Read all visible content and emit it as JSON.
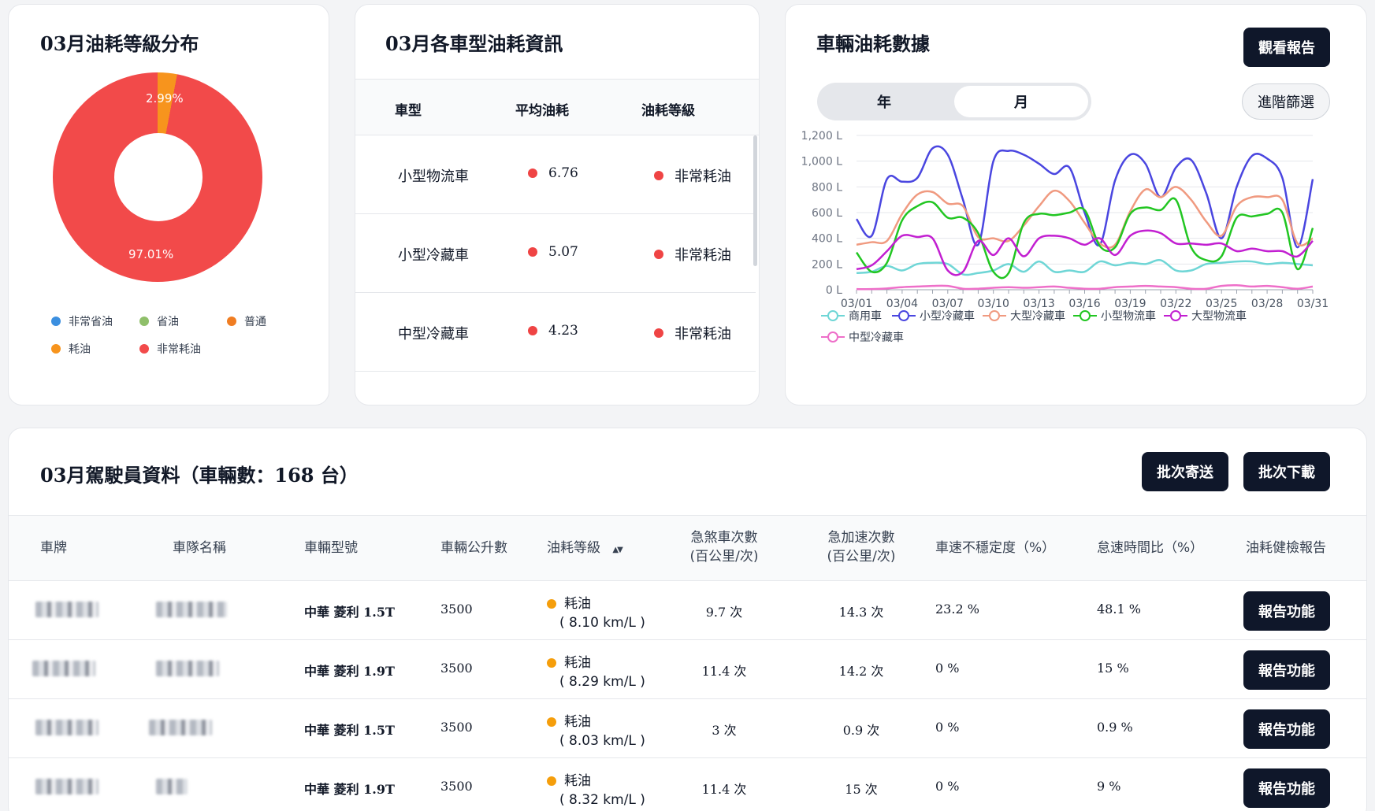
{
  "dist_card": {
    "title": "03月油耗等級分布",
    "slice_small_label": "2.99%",
    "slice_big_label": "97.01%",
    "legend": [
      {
        "label": "非常省油",
        "color": "#3b8fe0"
      },
      {
        "label": "省油",
        "color": "#8fbf6a"
      },
      {
        "label": "普通",
        "color": "#f07d22"
      },
      {
        "label": "耗油",
        "color": "#f7941d"
      },
      {
        "label": "非常耗油",
        "color": "#f24a4a"
      }
    ]
  },
  "model_card": {
    "title": "03月各車型油耗資訊",
    "headers": [
      "車型",
      "平均油耗",
      "油耗等級"
    ],
    "rows": [
      {
        "model": "小型物流車",
        "avg": "6.76",
        "grade": "非常耗油"
      },
      {
        "model": "小型冷藏車",
        "avg": "5.07",
        "grade": "非常耗油"
      },
      {
        "model": "中型冷藏車",
        "avg": "4.23",
        "grade": "非常耗油"
      }
    ]
  },
  "fuel_card": {
    "title": "車輛油耗數據",
    "report_button": "觀看報告",
    "filter_button": "進階篩選",
    "seg_year": "年",
    "seg_month": "月"
  },
  "chart_data": {
    "type": "line",
    "categories": [
      "03/01",
      "03/02",
      "03/03",
      "03/04",
      "03/05",
      "03/06",
      "03/07",
      "03/08",
      "03/09",
      "03/10",
      "03/11",
      "03/12",
      "03/13",
      "03/14",
      "03/15",
      "03/16",
      "03/17",
      "03/18",
      "03/19",
      "03/20",
      "03/21",
      "03/22",
      "03/23",
      "03/24",
      "03/25",
      "03/26",
      "03/27",
      "03/28",
      "03/29",
      "03/30",
      "03/31"
    ],
    "tick_labels": [
      "03/01",
      "03/04",
      "03/07",
      "03/10",
      "03/13",
      "03/16",
      "03/19",
      "03/22",
      "03/25",
      "03/28",
      "03/31"
    ],
    "y_ticks": [
      "0 L",
      "200 L",
      "400 L",
      "600 L",
      "800 L",
      "1,000 L",
      "1,200 L"
    ],
    "ylim": [
      0,
      1200
    ],
    "grid": true,
    "legend_position": "bottom",
    "series": [
      {
        "name": "商用車",
        "color": "#6fd6d6",
        "values": [
          130,
          140,
          185,
          150,
          200,
          210,
          200,
          120,
          130,
          150,
          200,
          140,
          220,
          140,
          150,
          140,
          220,
          190,
          210,
          200,
          230,
          150,
          150,
          200,
          210,
          220,
          220,
          200,
          210,
          200,
          190
        ]
      },
      {
        "name": "小型冷藏車",
        "color": "#4a46e0",
        "values": [
          550,
          420,
          860,
          840,
          870,
          1100,
          1050,
          700,
          350,
          1000,
          1080,
          1050,
          980,
          900,
          950,
          600,
          350,
          850,
          1050,
          980,
          720,
          950,
          1010,
          750,
          400,
          800,
          1040,
          1020,
          870,
          330,
          860
        ]
      },
      {
        "name": "大型冷藏車",
        "color": "#f09a80",
        "values": [
          350,
          370,
          380,
          590,
          740,
          760,
          670,
          650,
          410,
          400,
          380,
          500,
          650,
          770,
          690,
          520,
          360,
          350,
          610,
          780,
          720,
          800,
          700,
          530,
          420,
          650,
          720,
          720,
          700,
          360,
          400
        ]
      },
      {
        "name": "小型物流車",
        "color": "#22c622",
        "values": [
          290,
          140,
          210,
          540,
          650,
          680,
          560,
          560,
          440,
          140,
          130,
          520,
          590,
          580,
          600,
          620,
          340,
          330,
          590,
          640,
          620,
          700,
          330,
          230,
          260,
          560,
          570,
          590,
          600,
          160,
          480
        ]
      },
      {
        "name": "大型物流車",
        "color": "#c21fd1",
        "values": [
          160,
          190,
          300,
          420,
          410,
          400,
          150,
          140,
          380,
          270,
          400,
          260,
          400,
          420,
          400,
          350,
          400,
          270,
          420,
          460,
          440,
          360,
          360,
          350,
          360,
          300,
          320,
          300,
          300,
          260,
          380
        ]
      },
      {
        "name": "中型冷藏車",
        "color": "#ee6fc9",
        "values": [
          5,
          5,
          10,
          20,
          25,
          30,
          30,
          8,
          8,
          15,
          20,
          15,
          20,
          25,
          15,
          8,
          8,
          20,
          25,
          30,
          25,
          20,
          8,
          8,
          30,
          35,
          25,
          30,
          20,
          8,
          25
        ]
      }
    ]
  },
  "drivers_card": {
    "title": "03月駕駛員資料（車輛數：168 台）",
    "batch_send": "批次寄送",
    "batch_download": "批次下載",
    "headers": {
      "plate": "車牌",
      "fleet": "車隊名稱",
      "vehicle_model": "車輛型號",
      "liters": "車輛公升數",
      "grade": "油耗等級",
      "brake_1": "急煞車次數",
      "brake_2": "(百公里/次)",
      "accel_1": "急加速次數",
      "accel_2": "(百公里/次)",
      "speed_var": "車速不穩定度（%）",
      "idle": "怠速時間比（%）",
      "report": "油耗健檢報告"
    },
    "sort_icon": "▲▼",
    "rows": [
      {
        "model": "中華 菱利 1.5T",
        "liters": "3500",
        "grade": "耗油",
        "kml": "( 8.10 km/L )",
        "brake": "9.7 次",
        "accel": "14.3 次",
        "speed_var": "23.2 %",
        "idle": "48.1 %",
        "report": "報告功能"
      },
      {
        "model": "中華 菱利 1.9T",
        "liters": "3500",
        "grade": "耗油",
        "kml": "( 8.29 km/L )",
        "brake": "11.4 次",
        "accel": "14.2 次",
        "speed_var": "0 %",
        "idle": "15 %",
        "report": "報告功能"
      },
      {
        "model": "中華 菱利 1.5T",
        "liters": "3500",
        "grade": "耗油",
        "kml": "( 8.03 km/L )",
        "brake": "3 次",
        "accel": "0.9 次",
        "speed_var": "0 %",
        "idle": "0.9 %",
        "report": "報告功能"
      },
      {
        "model": "中華 菱利 1.9T",
        "liters": "3500",
        "grade": "耗油",
        "kml": "( 8.32 km/L )",
        "brake": "11.4 次",
        "accel": "15 次",
        "speed_var": "0 %",
        "idle": "9 %",
        "report": "報告功能"
      }
    ]
  }
}
